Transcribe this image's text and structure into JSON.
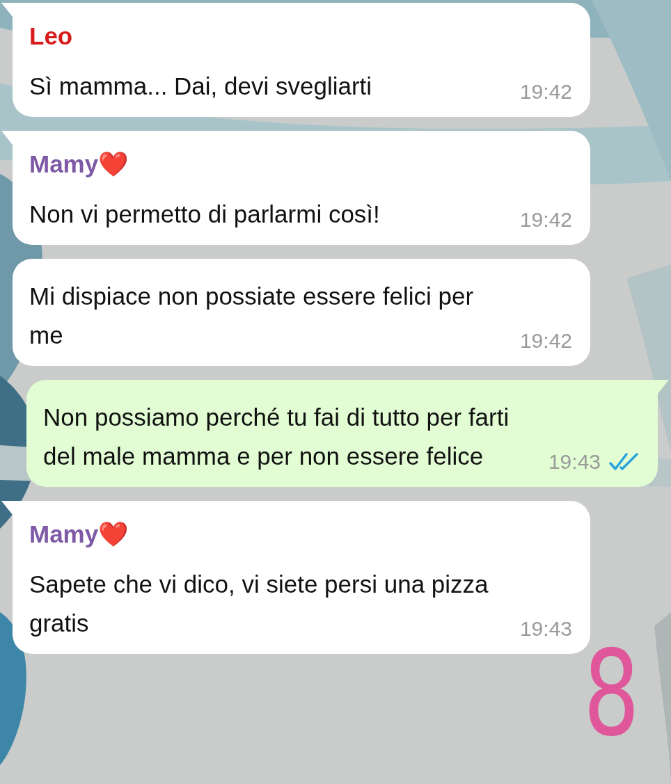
{
  "messages": [
    {
      "kind": "incoming",
      "tail": true,
      "sender": "Leo",
      "color": "#d81b1b",
      "text": "Sì mamma... Dai, devi svegliarti",
      "time": "19:42"
    },
    {
      "kind": "incoming",
      "tail": true,
      "sender": "Mamy❤️",
      "color": "#7e5aa6",
      "text": "Non vi permetto di parlarmi così!",
      "time": "19:42"
    },
    {
      "kind": "incoming",
      "tail": false,
      "text": "Mi dispiace non possiate essere felici per me",
      "time": "19:42"
    },
    {
      "kind": "outgoing",
      "tail": true,
      "text": "Non possiamo perché tu fai di tutto per farti del male mamma e per non essere felice",
      "time": "19:43",
      "read": true
    },
    {
      "kind": "incoming",
      "tail": true,
      "sender": "Mamy❤️",
      "color": "#7e5aa6",
      "text": "Sapete che vi dico, vi siete persi una pizza gratis",
      "time": "19:43"
    }
  ],
  "annotation": {
    "text": "8",
    "color": "#e0569a"
  }
}
